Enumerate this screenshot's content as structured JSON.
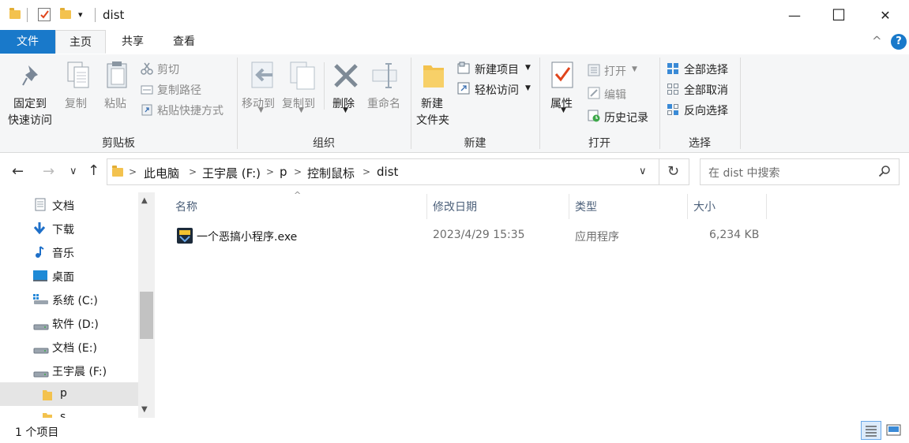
{
  "window": {
    "title": "dist",
    "minimize_glyph": "—",
    "maximize_glyph": "☐",
    "close_glyph": "✕"
  },
  "quick_access": {
    "customize_glyph": "▾"
  },
  "tabs": [
    {
      "label": "文件"
    },
    {
      "label": "主页"
    },
    {
      "label": "共享"
    },
    {
      "label": "查看"
    }
  ],
  "ribbon": {
    "collapse_glyph": "^",
    "help_glyph": "?",
    "clipboard": {
      "group_label": "剪贴板",
      "pin_line1": "固定到",
      "pin_line2": "快速访问",
      "copy": "复制",
      "paste": "粘贴",
      "cut": "剪切",
      "copy_path": "复制路径",
      "paste_shortcut": "粘贴快捷方式"
    },
    "organize": {
      "group_label": "组织",
      "move_to": "移动到",
      "copy_to": "复制到",
      "delete": "删除",
      "rename": "重命名"
    },
    "new": {
      "group_label": "新建",
      "new_folder_line1": "新建",
      "new_folder_line2": "文件夹",
      "new_item": "新建项目",
      "easy_access": "轻松访问"
    },
    "open": {
      "group_label": "打开",
      "properties": "属性",
      "open": "打开",
      "edit": "编辑",
      "history": "历史记录"
    },
    "select": {
      "group_label": "选择",
      "select_all": "全部选择",
      "select_none": "全部取消",
      "invert": "反向选择"
    }
  },
  "address": {
    "back": "←",
    "forward": "→",
    "recent": "∨",
    "up": "↑",
    "crumbs": [
      "此电脑",
      "王宇晨 (F:)",
      "p",
      "控制鼠标",
      "dist"
    ],
    "crumb_sep": ">",
    "dropdown": "∨",
    "refresh": "↻",
    "search_placeholder": "在 dist 中搜索"
  },
  "nav": {
    "items": [
      {
        "label": "文档",
        "icon": "document-icon"
      },
      {
        "label": "下载",
        "icon": "download-icon"
      },
      {
        "label": "音乐",
        "icon": "music-icon"
      },
      {
        "label": "桌面",
        "icon": "desktop-icon"
      },
      {
        "label": "系统 (C:)",
        "icon": "windows-drive-icon"
      },
      {
        "label": "软件 (D:)",
        "icon": "drive-icon"
      },
      {
        "label": "文档 (E:)",
        "icon": "drive-icon"
      },
      {
        "label": "王宇晨 (F:)",
        "icon": "drive-icon"
      },
      {
        "label": "p",
        "icon": "folder-icon",
        "selected": true
      },
      {
        "label": "s",
        "icon": "folder-icon"
      }
    ],
    "scroll_up": "▲",
    "scroll_down": "▼"
  },
  "columns": {
    "name": "名称",
    "date": "修改日期",
    "type": "类型",
    "size": "大小",
    "sort_glyph": "^"
  },
  "files": [
    {
      "name": "一个恶搞小程序.exe",
      "date": "2023/4/29 15:35",
      "type": "应用程序",
      "size": "6,234 KB"
    }
  ],
  "status": {
    "count": "1 个项目"
  },
  "colors": {
    "accent": "#1979ca",
    "folder": "#f3c24e",
    "selected_bg": "#e5e5e5"
  }
}
